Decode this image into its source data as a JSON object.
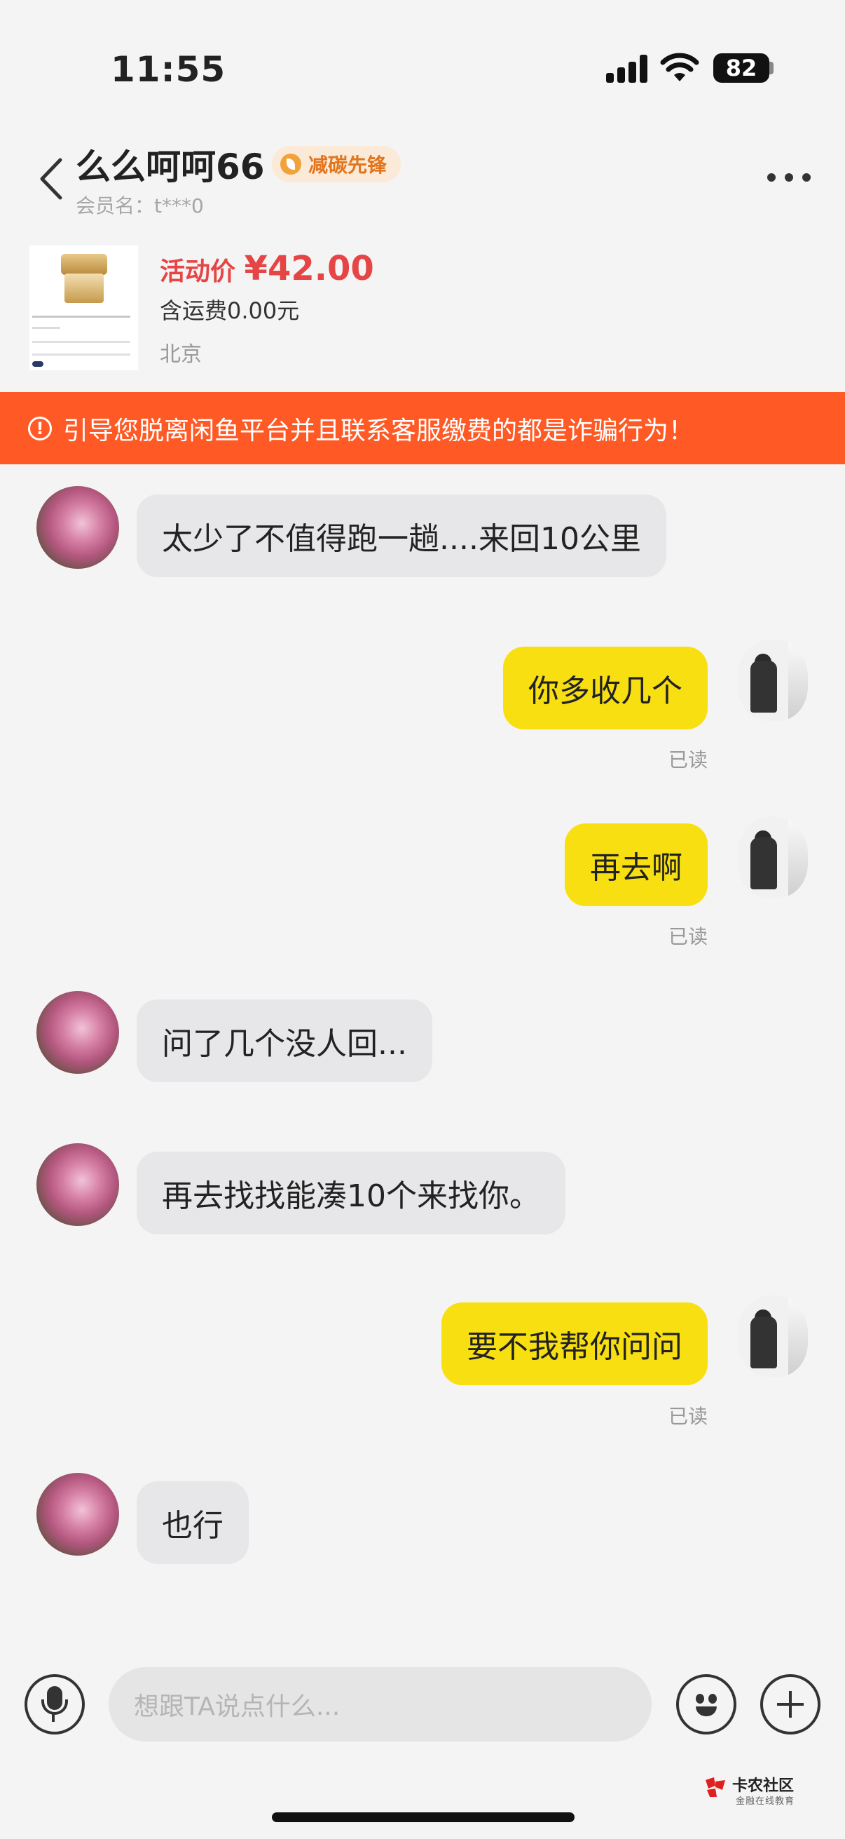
{
  "status_bar": {
    "time": "11:55",
    "battery": "82"
  },
  "header": {
    "title": "么么呵呵66",
    "badge": "减碳先锋",
    "member_label": "会员名：t***0"
  },
  "product": {
    "price_label": "活动价 ",
    "price": "¥42.00",
    "shipping": "含运费0.00元",
    "location": "北京"
  },
  "banner": {
    "text": "引导您脱离闲鱼平台并且联系客服缴费的都是诈骗行为！"
  },
  "messages": [
    {
      "from": "other",
      "text": "太少了不值得跑一趟....来回10公里"
    },
    {
      "from": "self",
      "text": "你多收几个",
      "status": "已读"
    },
    {
      "from": "self",
      "text": "再去啊",
      "status": "已读"
    },
    {
      "from": "other",
      "text": "问了几个没人回..."
    },
    {
      "from": "other",
      "text": "再去找找能凑10个来找你。"
    },
    {
      "from": "self",
      "text": "要不我帮你问问",
      "status": "已读"
    },
    {
      "from": "other",
      "text": "也行"
    }
  ],
  "input": {
    "placeholder": "想跟TA说点什么..."
  },
  "watermark": {
    "title": "卡农社区",
    "subtitle": "金融在线教育"
  },
  "colors": {
    "accent_yellow": "#f8df12",
    "warning_orange": "#ff5a25",
    "price_red": "#e54545"
  }
}
